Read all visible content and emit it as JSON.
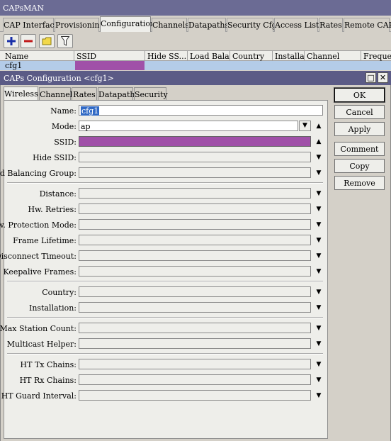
{
  "window": {
    "title": "CAPsMAN"
  },
  "main_tabs": [
    {
      "label": "CAP Interface"
    },
    {
      "label": "Provisioning"
    },
    {
      "label": "Configurations"
    },
    {
      "label": "Channels"
    },
    {
      "label": "Datapaths"
    },
    {
      "label": "Security Cfg."
    },
    {
      "label": "Access List"
    },
    {
      "label": "Rates"
    },
    {
      "label": "Remote CAP"
    }
  ],
  "toolbar": {
    "icons": [
      "plus-icon",
      "minus-icon",
      "folder-icon",
      "filter-icon"
    ]
  },
  "list": {
    "columns": [
      "Name",
      "SSID",
      "Hide SS...",
      "Load Bala...",
      "Country",
      "Installa...",
      "Channel",
      "Frequenc"
    ],
    "rows": [
      {
        "name": "cfg1",
        "ssid_color": "#a050a8"
      }
    ]
  },
  "dialog": {
    "title": "CAPs Configuration <cfg1>",
    "tabs": [
      "Wireless",
      "Channel",
      "Rates",
      "Datapath",
      "Security"
    ],
    "active_tab": "Wireless",
    "buttons": {
      "ok": "OK",
      "cancel": "Cancel",
      "apply": "Apply",
      "comment": "Comment",
      "copy": "Copy",
      "remove": "Remove"
    },
    "fields": {
      "name": {
        "label": "Name:",
        "value": "cfg1"
      },
      "mode": {
        "label": "Mode:",
        "value": "ap"
      },
      "ssid": {
        "label": "SSID:",
        "value": ""
      },
      "hide_ssid": {
        "label": "Hide SSID:"
      },
      "load_balancing_group": {
        "label": "Load Balancing Group:"
      },
      "distance": {
        "label": "Distance:"
      },
      "hw_retries": {
        "label": "Hw. Retries:"
      },
      "hw_protection_mode": {
        "label": "Hw. Protection Mode:"
      },
      "frame_lifetime": {
        "label": "Frame Lifetime:"
      },
      "disconnect_timeout": {
        "label": "Disconnect Timeout:"
      },
      "keepalive_frames": {
        "label": "Keepalive Frames:"
      },
      "country": {
        "label": "Country:"
      },
      "installation": {
        "label": "Installation:"
      },
      "max_station_count": {
        "label": "Max Station Count:"
      },
      "multicast_helper": {
        "label": "Multicast Helper:"
      },
      "ht_tx_chains": {
        "label": "HT Tx Chains:"
      },
      "ht_rx_chains": {
        "label": "HT Rx Chains:"
      },
      "ht_guard_interval": {
        "label": "HT Guard Interval:"
      }
    }
  },
  "colors": {
    "title_bar": "#5b5b86",
    "selection": "#b4cce8",
    "ssid_fill": "#a050a8"
  }
}
